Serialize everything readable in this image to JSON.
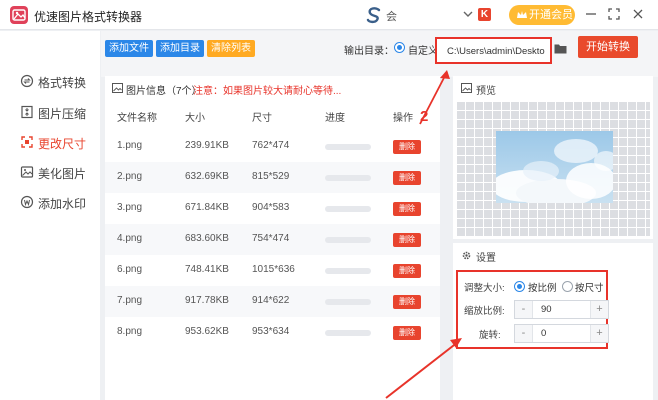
{
  "app": {
    "title": "优速图片格式转换器",
    "brand_text": "会",
    "vip_label": "开通会员",
    "badge_text": "K"
  },
  "sidebar": {
    "items": [
      {
        "label": "格式转换",
        "icon": "convert-icon",
        "active": false
      },
      {
        "label": "图片压缩",
        "icon": "compress-icon",
        "active": false
      },
      {
        "label": "更改尺寸",
        "icon": "resize-icon",
        "active": true
      },
      {
        "label": "美化图片",
        "icon": "beautify-icon",
        "active": false
      },
      {
        "label": "添加水印",
        "icon": "watermark-icon",
        "active": false
      }
    ]
  },
  "toolbar": {
    "add_file": "添加文件",
    "add_folder": "添加目录",
    "clear_list": "清除列表",
    "output_label": "输出目录：",
    "custom_label": "自定义",
    "output_path": "C:\\Users\\admin\\Desktop",
    "start_label": "开始转换"
  },
  "filelist": {
    "info_title": "图片信息（7个）",
    "notice": "注意：如果图片较大请耐心等待...",
    "headers": {
      "name": "文件名称",
      "size": "大小",
      "dim": "尺寸",
      "progress": "进度",
      "action": "操作"
    },
    "delete_label": "删除",
    "rows": [
      {
        "name": "1.png",
        "size": "239.91KB",
        "dim": "762*474",
        "progress": 0
      },
      {
        "name": "2.png",
        "size": "632.69KB",
        "dim": "815*529",
        "progress": 0
      },
      {
        "name": "3.png",
        "size": "671.84KB",
        "dim": "904*583",
        "progress": 0
      },
      {
        "name": "4.png",
        "size": "683.60KB",
        "dim": "754*474",
        "progress": 0
      },
      {
        "name": "6.png",
        "size": "748.41KB",
        "dim": "1015*636",
        "progress": 0
      },
      {
        "name": "7.png",
        "size": "917.78KB",
        "dim": "914*622",
        "progress": 0
      },
      {
        "name": "8.png",
        "size": "953.62KB",
        "dim": "953*634",
        "progress": 0
      }
    ]
  },
  "annotation": {
    "number": "2"
  },
  "preview": {
    "title": "预览"
  },
  "settings": {
    "title": "设置",
    "resize_label": "调整大小:",
    "opt_ratio": "按比例",
    "opt_size": "按尺寸",
    "scale_label": "缩放比例:",
    "scale_value": "90",
    "rotate_label": "旋转:",
    "rotate_value": "0",
    "minus": "-",
    "plus": "+"
  },
  "colors": {
    "accent_red": "#e8442e",
    "blue_button": "#2b87e8",
    "orange_button": "#ffaa22",
    "vip_gold": "#ffbb33"
  }
}
